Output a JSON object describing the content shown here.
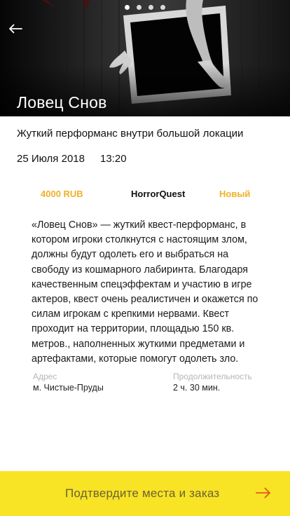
{
  "hero": {
    "title": "Ловец Снов",
    "carousel_total": 4,
    "carousel_active": 1
  },
  "event": {
    "subtitle": "Жуткий перформанс внутри большой локации",
    "date": "25 Июля 2018",
    "time": "13:20",
    "price": "4000 RUB",
    "organizer": "HorrorQuest",
    "badge": "Новый",
    "description": "«Ловец Снов» — жуткий квест-перформанс, в котором игроки столкнутся с настоящим злом, должны будут одолеть его и выбраться на свободу из кошмарного лабиринта. Благодаря качественным спецэффектам и участию в игре актеров, квест очень реалистичен и окажется по силам игрокам с крепкими нервами. Квест проходит на территории, площадью 150 кв. метров., наполненных жуткими предметами и артефактами, которые помогут одолеть зло.",
    "address_label": "Адрес",
    "address_value": "м. Чистые-Пруды",
    "duration_label": "Продолжительность",
    "duration_value": "2 ч.  30 мин."
  },
  "cta": {
    "label": "Подтвердите места и заказ"
  },
  "colors": {
    "accent": "#f0b028",
    "cta_bg": "#f8e325",
    "cta_text": "#6b6235",
    "cta_arrow": "#e05a1e"
  },
  "icons": {
    "back": "arrow-left-icon",
    "cta": "arrow-right-icon"
  }
}
